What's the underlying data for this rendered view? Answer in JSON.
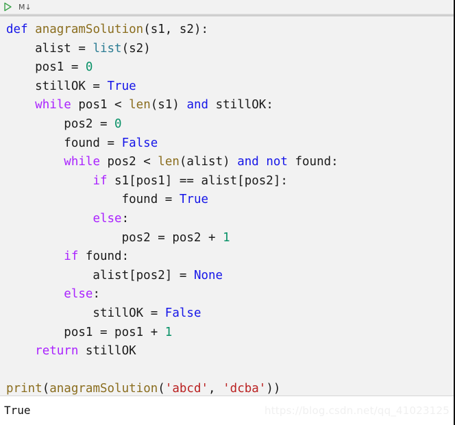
{
  "toolbar": {
    "run_icon": "play-triangle-icon",
    "run_label": "",
    "markdown_label": "M↓"
  },
  "code": {
    "language": "python",
    "lines": [
      [
        {
          "t": "def",
          "c": "t-def"
        },
        {
          "t": " ",
          "c": "t-plain"
        },
        {
          "t": "anagramSolution",
          "c": "t-fn"
        },
        {
          "t": "(s1, s2):",
          "c": "t-plain"
        }
      ],
      [
        {
          "t": "    alist = ",
          "c": "t-plain"
        },
        {
          "t": "list",
          "c": "t-builtin"
        },
        {
          "t": "(s2)",
          "c": "t-plain"
        }
      ],
      [
        {
          "t": "    pos1 = ",
          "c": "t-plain"
        },
        {
          "t": "0",
          "c": "t-num"
        }
      ],
      [
        {
          "t": "    stillOK = ",
          "c": "t-plain"
        },
        {
          "t": "True",
          "c": "t-bool"
        }
      ],
      [
        {
          "t": "    ",
          "c": "t-plain"
        },
        {
          "t": "while",
          "c": "t-kw"
        },
        {
          "t": " pos1 < ",
          "c": "t-plain"
        },
        {
          "t": "len",
          "c": "t-fn"
        },
        {
          "t": "(s1) ",
          "c": "t-plain"
        },
        {
          "t": "and",
          "c": "t-bool"
        },
        {
          "t": " stillOK:",
          "c": "t-plain"
        }
      ],
      [
        {
          "t": "        pos2 = ",
          "c": "t-plain"
        },
        {
          "t": "0",
          "c": "t-num"
        }
      ],
      [
        {
          "t": "        found = ",
          "c": "t-plain"
        },
        {
          "t": "False",
          "c": "t-bool"
        }
      ],
      [
        {
          "t": "        ",
          "c": "t-plain"
        },
        {
          "t": "while",
          "c": "t-kw"
        },
        {
          "t": " pos2 < ",
          "c": "t-plain"
        },
        {
          "t": "len",
          "c": "t-fn"
        },
        {
          "t": "(alist) ",
          "c": "t-plain"
        },
        {
          "t": "and",
          "c": "t-bool"
        },
        {
          "t": " ",
          "c": "t-plain"
        },
        {
          "t": "not",
          "c": "t-bool"
        },
        {
          "t": " found:",
          "c": "t-plain"
        }
      ],
      [
        {
          "t": "            ",
          "c": "t-plain"
        },
        {
          "t": "if",
          "c": "t-kw"
        },
        {
          "t": " s1[pos1] == alist[pos2]:",
          "c": "t-plain"
        }
      ],
      [
        {
          "t": "                found = ",
          "c": "t-plain"
        },
        {
          "t": "True",
          "c": "t-bool"
        }
      ],
      [
        {
          "t": "            ",
          "c": "t-plain"
        },
        {
          "t": "else",
          "c": "t-kw"
        },
        {
          "t": ":",
          "c": "t-plain"
        }
      ],
      [
        {
          "t": "                pos2 = pos2 + ",
          "c": "t-plain"
        },
        {
          "t": "1",
          "c": "t-num"
        }
      ],
      [
        {
          "t": "        ",
          "c": "t-plain"
        },
        {
          "t": "if",
          "c": "t-kw"
        },
        {
          "t": " found:",
          "c": "t-plain"
        }
      ],
      [
        {
          "t": "            alist[pos2] = ",
          "c": "t-plain"
        },
        {
          "t": "None",
          "c": "t-bool"
        }
      ],
      [
        {
          "t": "        ",
          "c": "t-plain"
        },
        {
          "t": "else",
          "c": "t-kw"
        },
        {
          "t": ":",
          "c": "t-plain"
        }
      ],
      [
        {
          "t": "            stillOK = ",
          "c": "t-plain"
        },
        {
          "t": "False",
          "c": "t-bool"
        }
      ],
      [
        {
          "t": "        pos1 = pos1 + ",
          "c": "t-plain"
        },
        {
          "t": "1",
          "c": "t-num"
        }
      ],
      [
        {
          "t": "    ",
          "c": "t-plain"
        },
        {
          "t": "return",
          "c": "t-kw"
        },
        {
          "t": " stillOK",
          "c": "t-plain"
        }
      ],
      [],
      [
        {
          "t": "print",
          "c": "t-fn"
        },
        {
          "t": "(",
          "c": "t-plain"
        },
        {
          "t": "anagramSolution",
          "c": "t-fn"
        },
        {
          "t": "(",
          "c": "t-plain"
        },
        {
          "t": "'abcd'",
          "c": "t-str"
        },
        {
          "t": ", ",
          "c": "t-plain"
        },
        {
          "t": "'dcba'",
          "c": "t-str"
        },
        {
          "t": "))",
          "c": "t-plain"
        }
      ]
    ]
  },
  "output": {
    "text": "True",
    "watermark": "https://blog.csdn.net/qq_41023125"
  },
  "colors": {
    "keyword": "#aa22ff",
    "definition": "#1515e8",
    "builtin_constant": "#1515e8",
    "function": "#8a6d1e",
    "builtin_type": "#2b7c93",
    "number": "#089167",
    "string": "#ba2121",
    "plain_text": "#1a1a1a",
    "editor_background": "#f2f2f2",
    "output_background": "#ffffff",
    "run_icon": "#3aa049"
  }
}
